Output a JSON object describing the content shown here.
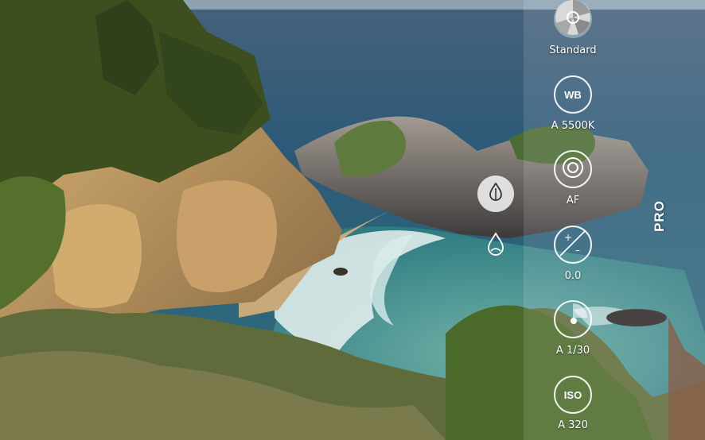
{
  "mode": {
    "label": "PRO"
  },
  "controls": {
    "standard": {
      "label": "Standard",
      "icon": "color-tone-icon"
    },
    "wb": {
      "icon_text": "WB",
      "value": "A 5500K"
    },
    "af": {
      "label": "AF",
      "icon": "focus-ring-icon"
    },
    "exposure": {
      "value": "0.0",
      "icon": "exposure-compensation-icon"
    },
    "shutter": {
      "value": "A 1/30",
      "icon": "shutter-speed-icon"
    },
    "iso": {
      "icon_text": "ISO",
      "value": "A 320"
    }
  },
  "effects": {
    "filter_selected_icon": "drops-icon",
    "filter_alt_icon": "drops-outline-icon"
  }
}
